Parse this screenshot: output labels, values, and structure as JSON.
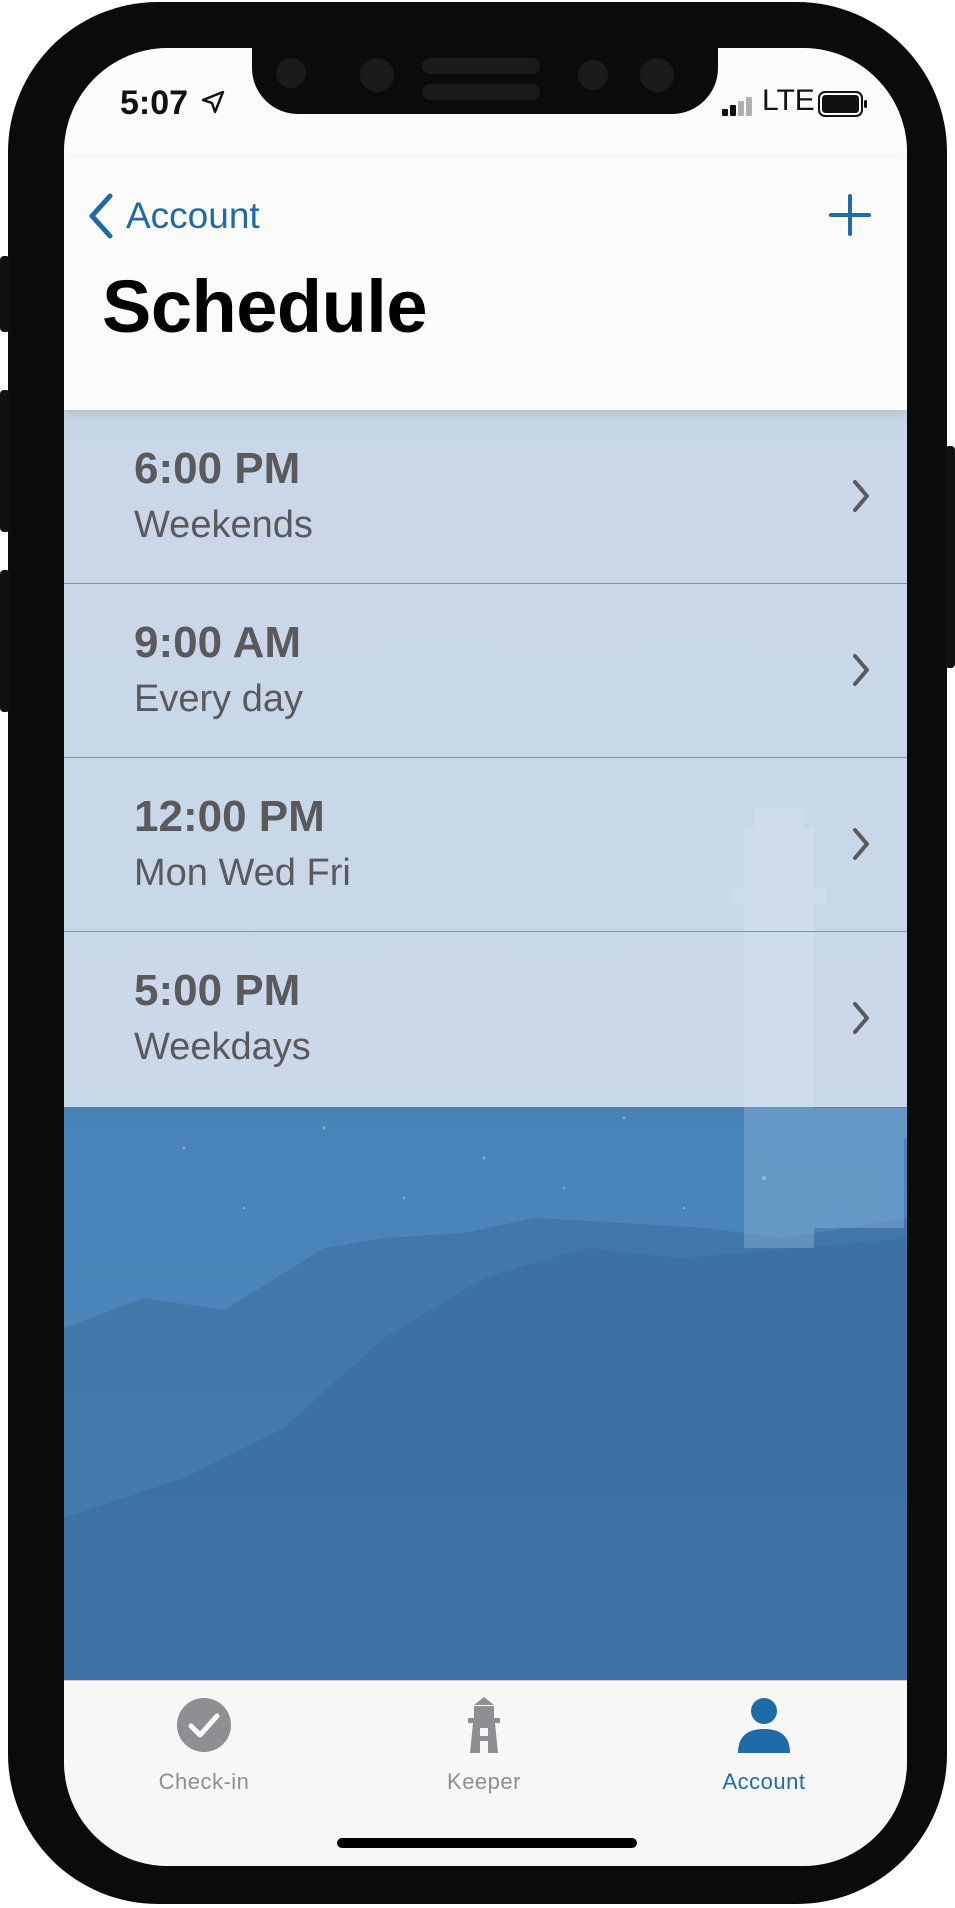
{
  "status_bar": {
    "time": "5:07",
    "network": "LTE",
    "icons": [
      "location-arrow-icon",
      "signal-bars-icon",
      "battery-icon"
    ]
  },
  "nav": {
    "back_label": "Account",
    "title": "Schedule",
    "back_icon": "chevron-left-icon",
    "add_icon": "plus-icon"
  },
  "schedules": [
    {
      "time": "6:00 PM",
      "days": "Weekends"
    },
    {
      "time": "9:00 AM",
      "days": "Every day"
    },
    {
      "time": "12:00 PM",
      "days": "Mon Wed Fri"
    },
    {
      "time": "5:00 PM",
      "days": "Weekdays"
    }
  ],
  "tabs": [
    {
      "label": "Check-in",
      "icon": "checkmark-circle-icon",
      "active": false
    },
    {
      "label": "Keeper",
      "icon": "lighthouse-icon",
      "active": false
    },
    {
      "label": "Account",
      "icon": "person-icon",
      "active": true
    }
  ],
  "colors": {
    "accent": "#1e6ba8",
    "inactive_tab": "#8e8e93",
    "background_blue": "#4a86bd",
    "row_text": "#5a5a5c"
  }
}
